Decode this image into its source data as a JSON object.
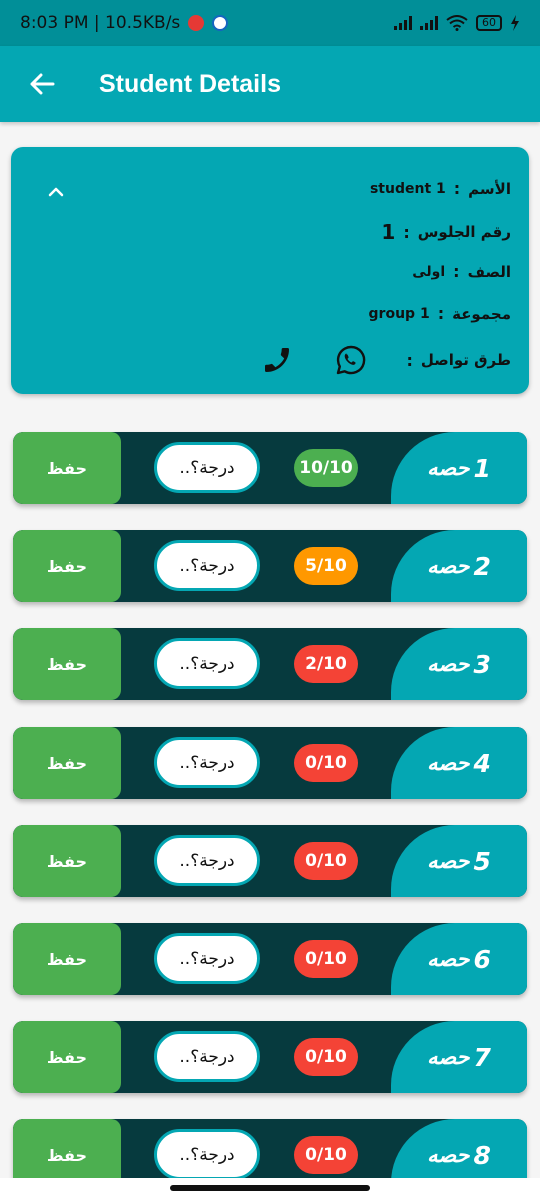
{
  "status_bar": {
    "time_speed": "8:03 PM | 10.5KB/s",
    "battery": "60"
  },
  "app_bar": {
    "back_icon": "arrow-left-icon",
    "title": "Student Details"
  },
  "student": {
    "name_label": "الأسم",
    "name_value": "student 1",
    "seat_label": "رقم الجلوس",
    "seat_value": "1",
    "class_label": "الصف",
    "class_value": "اولى",
    "group_label": "مجموعة",
    "group_value": "group 1",
    "contact_label": "طرق تواصل",
    "colon": ":",
    "collapse_icon": "chevron-up-icon",
    "whatsapp_icon": "whatsapp-icon",
    "phone_icon": "phone-icon"
  },
  "sessions": [
    {
      "label": "حصه",
      "number": "1",
      "score": "10/10",
      "score_color": "#4caf50",
      "grade_placeholder": "..درجة؟",
      "save_label": "حفظ"
    },
    {
      "label": "حصه",
      "number": "2",
      "score": "5/10",
      "score_color": "#ff9800",
      "grade_placeholder": "..درجة؟",
      "save_label": "حفظ"
    },
    {
      "label": "حصه",
      "number": "3",
      "score": "2/10",
      "score_color": "#f44336",
      "grade_placeholder": "..درجة؟",
      "save_label": "حفظ"
    },
    {
      "label": "حصه",
      "number": "4",
      "score": "0/10",
      "score_color": "#f44336",
      "grade_placeholder": "..درجة؟",
      "save_label": "حفظ"
    },
    {
      "label": "حصه",
      "number": "5",
      "score": "0/10",
      "score_color": "#f44336",
      "grade_placeholder": "..درجة؟",
      "save_label": "حفظ"
    },
    {
      "label": "حصه",
      "number": "6",
      "score": "0/10",
      "score_color": "#f44336",
      "grade_placeholder": "..درجة؟",
      "save_label": "حفظ"
    },
    {
      "label": "حصه",
      "number": "7",
      "score": "0/10",
      "score_color": "#f44336",
      "grade_placeholder": "..درجة؟",
      "save_label": "حفظ"
    },
    {
      "label": "حصه",
      "number": "8",
      "score": "0/10",
      "score_color": "#f44336",
      "grade_placeholder": "..درجة؟",
      "save_label": "حفظ"
    }
  ],
  "colors": {
    "primary": "#04a7b3",
    "dark_teal": "#063a3e",
    "save_green": "#4caf50"
  }
}
